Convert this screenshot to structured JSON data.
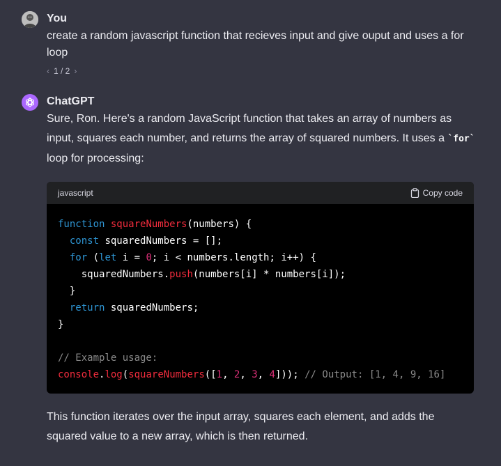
{
  "user_message": {
    "author": "You",
    "text": "create a random javascript function that recieves input and give ouput and uses a for loop",
    "pager": {
      "prev": "‹",
      "label": "1 / 2",
      "next": "›"
    }
  },
  "assistant_message": {
    "author": "ChatGPT",
    "intro_before_code": "Sure, Ron. Here's a random JavaScript function that takes an array of numbers as input, squares each number, and returns the array of squared numbers. It uses a ",
    "inline_code": "`for`",
    "intro_after_code": " loop for processing:",
    "code_block": {
      "language": "javascript",
      "copy_label": "Copy code",
      "line1": {
        "kw": "function",
        "fn": "squareNumbers",
        "rest": "(numbers) {"
      },
      "line2": {
        "indent": "  ",
        "kw": "const",
        "rest": " squaredNumbers = [];"
      },
      "line3": {
        "indent": "  ",
        "kw1": "for",
        "p1": " (",
        "kw2": "let",
        "p2": " i = ",
        "num": "0",
        "rest": "; i < numbers.length; i++) {"
      },
      "line4": {
        "pre": "    squaredNumbers.",
        "fn": "push",
        "rest": "(numbers[i] * numbers[i]);"
      },
      "line5": "  }",
      "line6": {
        "indent": "  ",
        "kw": "return",
        "rest": " squaredNumbers;"
      },
      "line7": "}",
      "line9": "// Example usage:",
      "line10": {
        "obj": "console",
        "dot": ".",
        "fn1": "log",
        "p1": "(",
        "fn2": "squareNumbers",
        "p2": "([",
        "n1": "1",
        "c1": ", ",
        "n2": "2",
        "c2": ", ",
        "n3": "3",
        "c3": ", ",
        "n4": "4",
        "p3": "])); ",
        "comment": "// Output: [1, 4, 9, 16]"
      }
    },
    "outro": "This function iterates over the input array, squares each element, and adds the squared value to a new array, which is then returned."
  },
  "colors": {
    "background": "#343541",
    "keyword": "#2e95d3",
    "function": "#f22c3d",
    "number": "#df3079",
    "gpt_avatar": "#ab68ff"
  }
}
